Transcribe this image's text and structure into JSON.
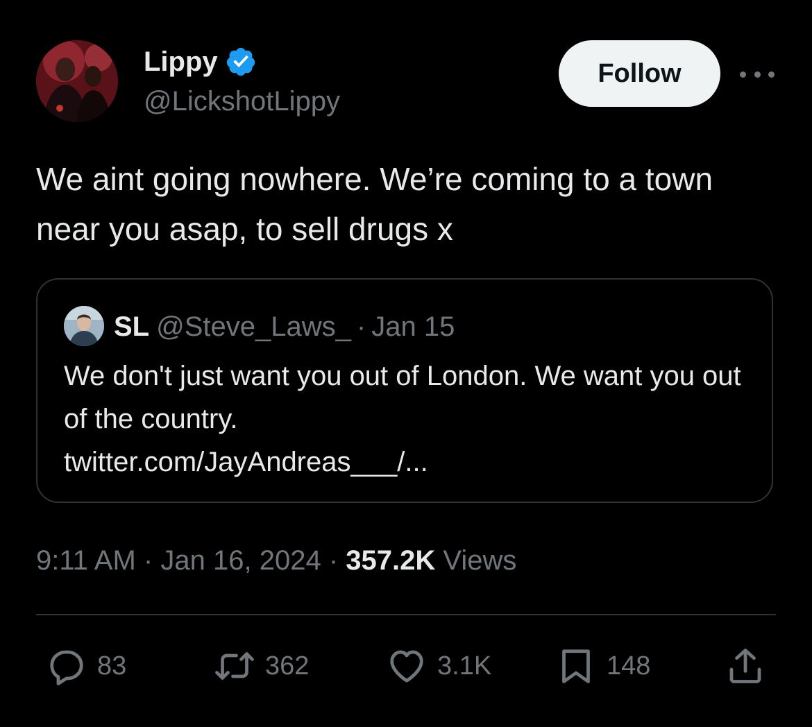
{
  "author": {
    "display_name": "Lippy",
    "handle": "@LickshotLippy",
    "verified": true
  },
  "follow_label": "Follow",
  "tweet_text": "We aint going nowhere. We’re coming to a town near you asap, to sell drugs x",
  "quoted": {
    "name": "SL",
    "handle": "@Steve_Laws_",
    "separator": "·",
    "date": "Jan 15",
    "text": "We don't just want you out of London. We want you out of the country.",
    "link": "twitter.com/JayAndreas___/..."
  },
  "meta": {
    "time": "9:11 AM",
    "sep1": "·",
    "date": "Jan 16, 2024",
    "sep2": "·",
    "views_count": "357.2K",
    "views_label": "Views"
  },
  "actions": {
    "replies": "83",
    "reposts": "362",
    "likes": "3.1K",
    "bookmarks": "148"
  },
  "colors": {
    "background": "#000000",
    "text": "#e7e9ea",
    "secondary": "#71767b",
    "border": "#2f3336",
    "verified": "#1d9bf0"
  }
}
